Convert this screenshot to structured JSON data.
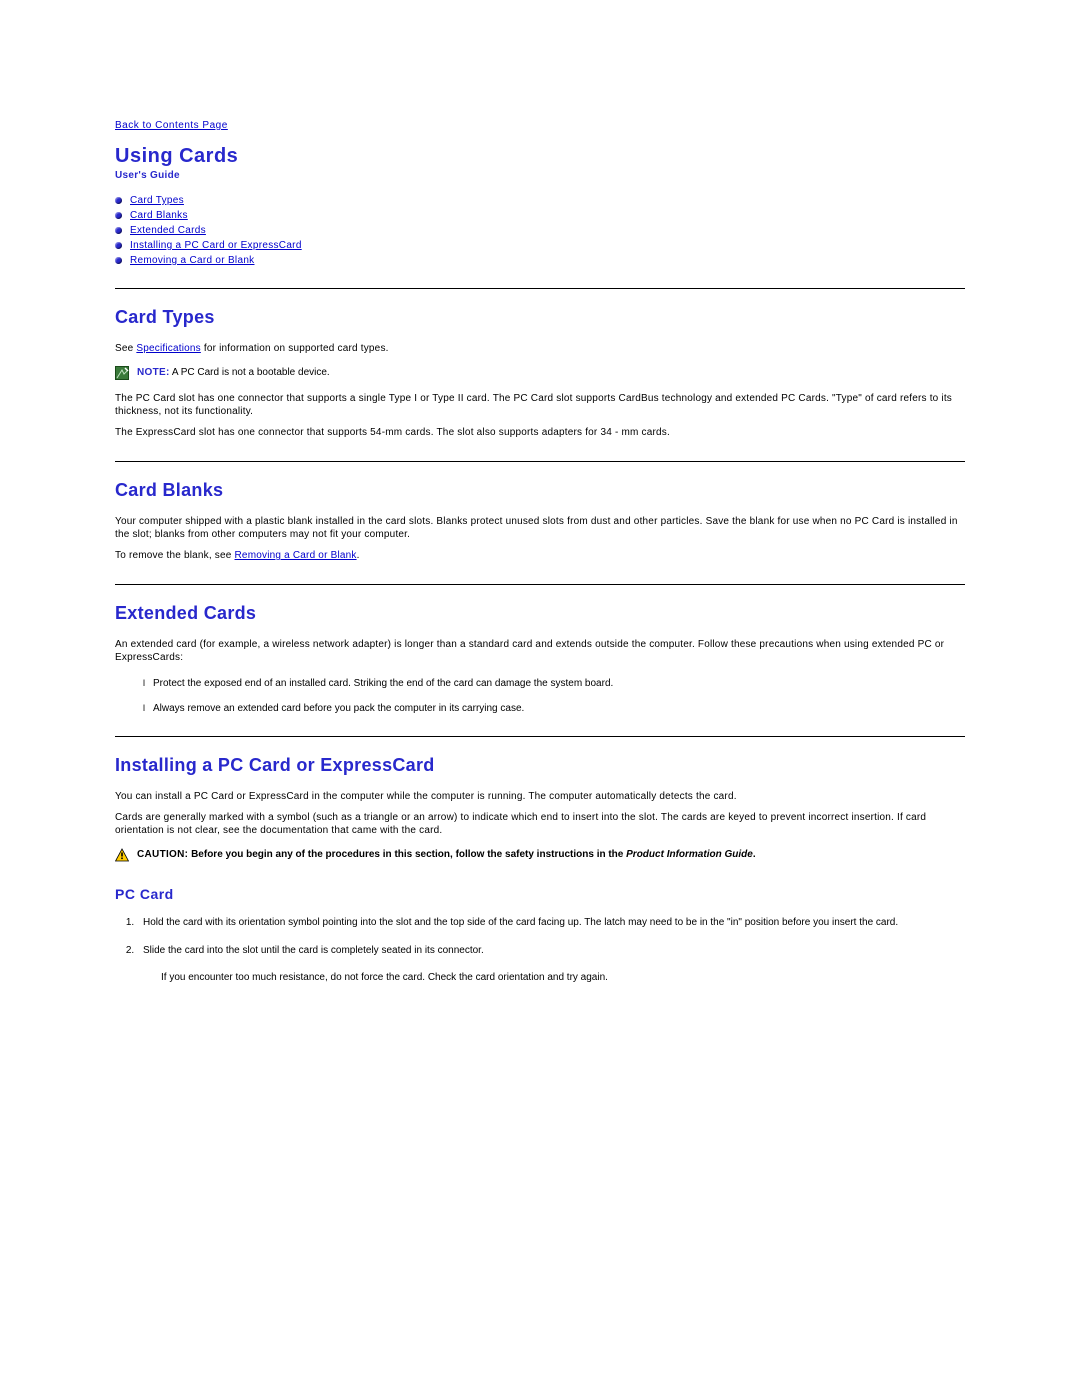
{
  "back_link": "Back to Contents Page",
  "page_title": "Using Cards",
  "subtitle": "User's Guide",
  "toc": [
    "Card Types",
    "Card Blanks",
    "Extended Cards",
    "Installing a PC Card or ExpressCard",
    "Removing a Card or Blank"
  ],
  "card_types": {
    "heading": "Card Types",
    "p1_pre": "See ",
    "p1_link": "Specifications",
    "p1_post": " for information on supported card types.",
    "note_label": "NOTE:",
    "note_text": " A PC Card is not a bootable device.",
    "p2": "The PC Card slot has one connector that supports a single Type I or Type II card. The PC Card slot supports CardBus technology and extended PC Cards. \"Type\" of card refers to its thickness, not its functionality.",
    "p3": "The ExpressCard slot has one connector that supports 54-mm cards. The slot also supports adapters for 34 - mm cards."
  },
  "card_blanks": {
    "heading": "Card Blanks",
    "p1": "Your computer shipped with a plastic blank installed in the card slots. Blanks protect unused slots from dust and other particles. Save the blank for use when no PC Card is installed in the slot; blanks from other computers may not fit your computer.",
    "p2_pre": "To remove the blank, see ",
    "p2_link": "Removing a Card or Blank",
    "p2_post": "."
  },
  "extended_cards": {
    "heading": "Extended Cards",
    "p1": "An extended card (for example, a wireless network adapter) is longer than a standard card and extends outside the computer. Follow these precautions when using extended PC or ExpressCards:",
    "precautions": [
      "Protect the exposed end of an installed card. Striking the end of the card can damage the system board.",
      "Always remove an extended card before you pack the computer in its carrying case."
    ]
  },
  "installing": {
    "heading": "Installing a PC Card or ExpressCard",
    "p1": "You can install a PC Card or ExpressCard in the computer while the computer is running. The computer automatically detects the card.",
    "p2": "Cards are generally marked with a symbol (such as a triangle or an arrow) to indicate which end to insert into the slot. The cards are keyed to prevent incorrect insertion. If card orientation is not clear, see the documentation that came with the card.",
    "caution_label": "CAUTION:",
    "caution_text_pre": " Before you begin any of the procedures in this section, follow the safety instructions in the ",
    "caution_text_italic": "Product Information Guide",
    "caution_text_post": ".",
    "pc_card_heading": "PC Card",
    "steps": [
      "Hold the card with its orientation symbol pointing into the slot and the top side of the card facing up. The latch may need to be in the \"in\" position before you insert the card.",
      "Slide the card into the slot until the card is completely seated in its connector."
    ],
    "step2_sub": "If you encounter too much resistance, do not force the card. Check the card orientation and try again."
  },
  "precaution_bullet": "l"
}
